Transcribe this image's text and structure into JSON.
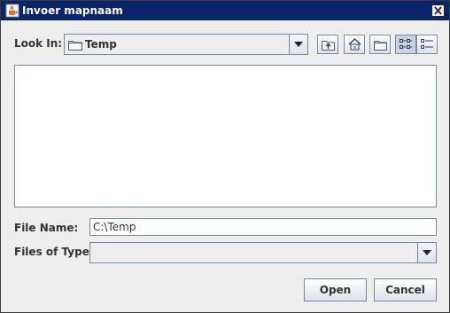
{
  "window": {
    "title": "Invoer mapnaam",
    "title_icon": "java-cup-icon",
    "close_icon": "close-icon"
  },
  "look_in": {
    "label": "Look In:",
    "mnemonic": "I",
    "value": "Temp",
    "folder_icon": "folder-icon"
  },
  "toolbar": {
    "up_one_level": "up-folder-icon",
    "home": "home-icon",
    "new_folder": "new-folder-icon",
    "list_view": "list-view-icon",
    "details_view": "details-view-icon",
    "active_view": "list"
  },
  "file_list": {
    "items": []
  },
  "file_name": {
    "label": "File Name:",
    "mnemonic": "N",
    "value": "C:\\Temp"
  },
  "files_of_type": {
    "label": "Files of Type:",
    "mnemonic": "T",
    "value": ""
  },
  "buttons": {
    "open": "Open",
    "cancel": "Cancel"
  },
  "colors": {
    "title_bar": "#0a246a",
    "panel": "#eeeeee",
    "border": "#7a8a99"
  }
}
